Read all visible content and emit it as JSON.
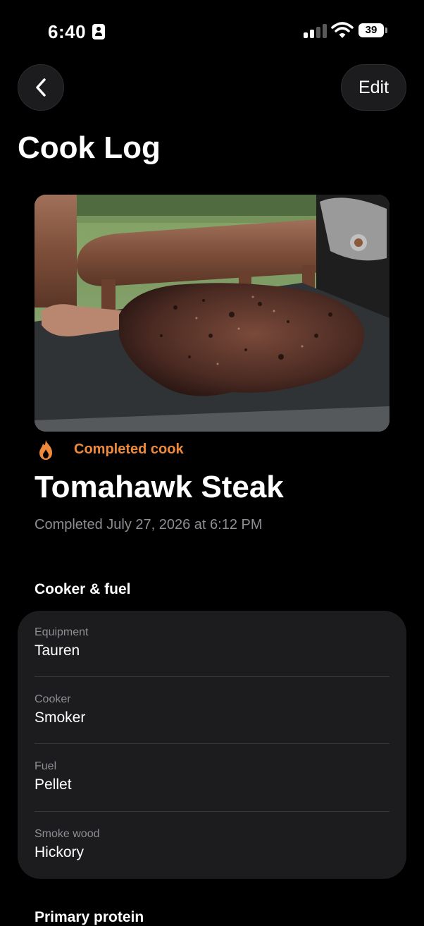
{
  "status_bar": {
    "time": "6:40",
    "battery": "39"
  },
  "nav": {
    "back_icon": "chevron-left-icon",
    "edit_label": "Edit"
  },
  "page_title": "Cook Log",
  "cook": {
    "status_icon": "flame-icon",
    "status_label": "Completed cook",
    "status_color": "#f08a3a",
    "title": "Tomahawk Steak",
    "completed_text": "Completed July 27, 2026 at 6:12 PM"
  },
  "cooker_section": {
    "title": "Cooker & fuel",
    "rows": [
      {
        "label": "Equipment",
        "value": "Tauren"
      },
      {
        "label": "Cooker",
        "value": "Smoker"
      },
      {
        "label": "Fuel",
        "value": "Pellet"
      },
      {
        "label": "Smoke wood",
        "value": "Hickory"
      }
    ]
  },
  "next_section_title": "Primary protein"
}
